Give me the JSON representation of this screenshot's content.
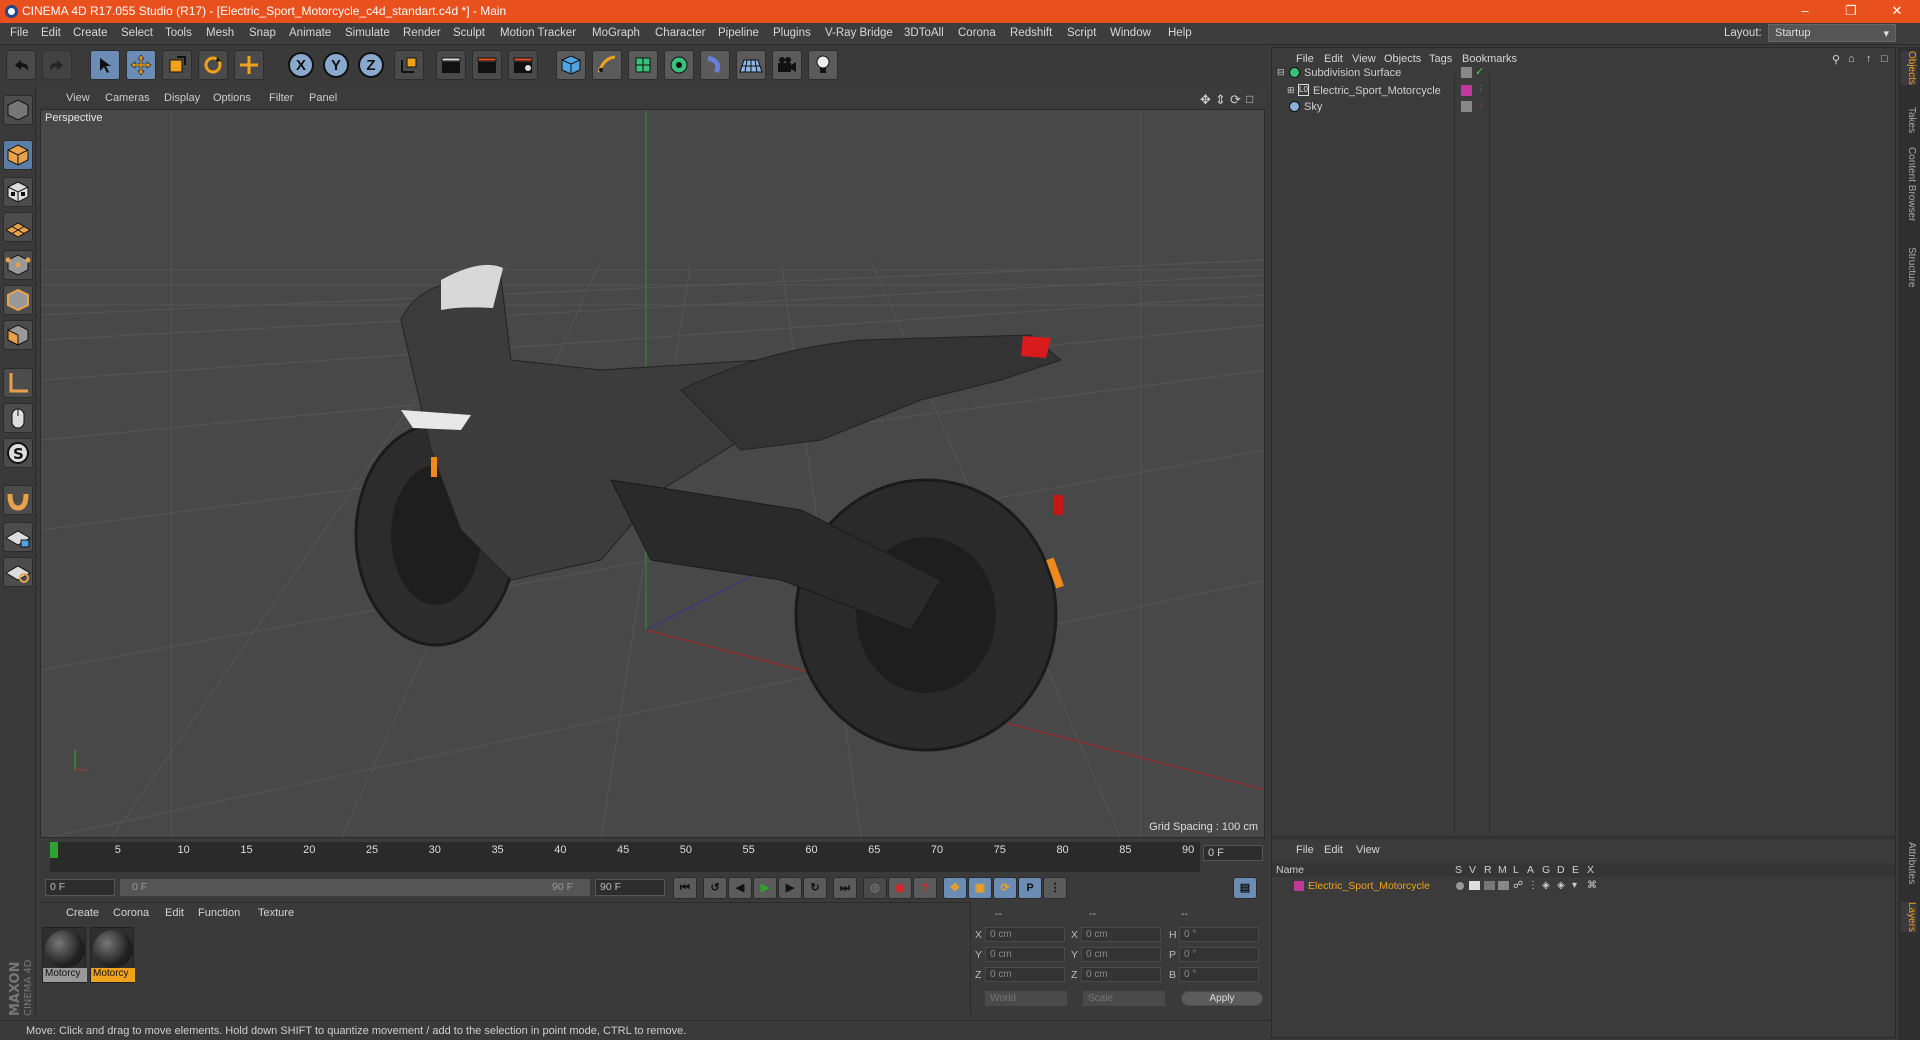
{
  "window": {
    "title": "CINEMA 4D R17.055 Studio (R17) - [Electric_Sport_Motorcycle_c4d_standart.c4d *] - Main"
  },
  "menubar": {
    "items": [
      "File",
      "Edit",
      "Create",
      "Select",
      "Tools",
      "Mesh",
      "Snap",
      "Animate",
      "Simulate",
      "Render",
      "Sculpt",
      "Motion Tracker",
      "MoGraph",
      "Character",
      "Pipeline",
      "Plugins",
      "V-Ray Bridge",
      "3DToAll",
      "Corona",
      "Redshift",
      "Script",
      "Window",
      "Help"
    ],
    "layout_label": "Layout:",
    "layout_value": "Startup"
  },
  "toolbar": {
    "axis_x": "X",
    "axis_y": "Y",
    "axis_z": "Z"
  },
  "viewport": {
    "menu": [
      "View",
      "Cameras",
      "Display",
      "Options",
      "Filter",
      "Panel"
    ],
    "label": "Perspective",
    "grid_spacing": "Grid Spacing : 100 cm"
  },
  "timeline": {
    "ticks": [
      "0",
      "5",
      "10",
      "15",
      "20",
      "25",
      "30",
      "35",
      "40",
      "45",
      "50",
      "55",
      "60",
      "65",
      "70",
      "75",
      "80",
      "85",
      "90"
    ],
    "current_frame": "0 F",
    "start_field": "0 F",
    "range_start": "0 F",
    "range_end": "90 F",
    "end_field": "90 F"
  },
  "materials": {
    "menu": [
      "Create",
      "Corona",
      "Edit",
      "Function",
      "Texture"
    ],
    "items": [
      {
        "label": "Motorcy",
        "selected": false
      },
      {
        "label": "Motorcy",
        "selected": true
      }
    ]
  },
  "coordinates": {
    "headers": [
      "--",
      "--",
      "--"
    ],
    "rows": [
      {
        "a": "X",
        "av": "0 cm",
        "b": "X",
        "bv": "0 cm",
        "c": "H",
        "cv": "0 °"
      },
      {
        "a": "Y",
        "av": "0 cm",
        "b": "Y",
        "bv": "0 cm",
        "c": "P",
        "cv": "0 °"
      },
      {
        "a": "Z",
        "av": "0 cm",
        "b": "Z",
        "bv": "0 cm",
        "c": "B",
        "cv": "0 °"
      }
    ],
    "mode1": "World",
    "mode2": "Scale",
    "apply": "Apply"
  },
  "status": {
    "text": "Move: Click and drag to move elements. Hold down SHIFT to quantize movement / add to the selection in point mode, CTRL to remove."
  },
  "object_manager": {
    "menu": [
      "File",
      "Edit",
      "View",
      "Objects",
      "Tags",
      "Bookmarks"
    ],
    "objects": [
      {
        "name": "Subdivision Surface"
      },
      {
        "name": "Electric_Sport_Motorcycle"
      },
      {
        "name": "Sky"
      }
    ]
  },
  "layer_manager": {
    "menu": [
      "File",
      "Edit",
      "View"
    ],
    "columns": [
      "Name",
      "S",
      "V",
      "R",
      "M",
      "L",
      "A",
      "G",
      "D",
      "E",
      "X"
    ],
    "layers": [
      {
        "name": "Electric_Sport_Motorcycle",
        "color": "#c0399a"
      }
    ]
  },
  "right_tabs": [
    "Objects",
    "Takes",
    "Content Browser",
    "Structure",
    "Attributes",
    "Layers"
  ],
  "colors": {
    "title_bar": "#e8501e",
    "accent": "#f0a21c",
    "selection_blue": "#6b8db5"
  },
  "branding": {
    "maxon": "MAXON",
    "product": "CINEMA 4D"
  }
}
